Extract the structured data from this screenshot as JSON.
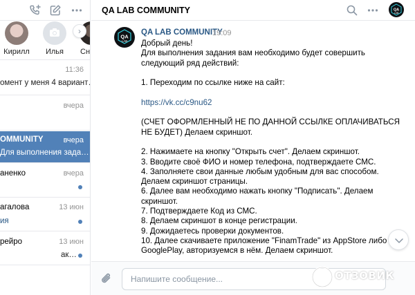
{
  "stories": [
    {
      "name": "Кирилл",
      "avatar_color": "#c4a9a3"
    },
    {
      "name": "Илья",
      "avatar_color": "#dfe3e8"
    },
    {
      "name": "Сне",
      "avatar_color": "#3b3431"
    }
  ],
  "dialogs": [
    {
      "name": "",
      "time": "11:36",
      "preview": "омент у меня 4 вариант…",
      "unread": false,
      "active": false
    },
    {
      "name": "",
      "time": "вчера",
      "preview": "",
      "unread": false,
      "active": false
    },
    {
      "name": "OMMUNITY",
      "time": "вчера",
      "preview": "Для выполнения зада…",
      "unread": false,
      "active": true
    },
    {
      "name": "аненко",
      "time": "вчера",
      "preview": "",
      "unread": true,
      "active": false
    },
    {
      "name": "агалова",
      "time": "13 июн",
      "preview": "ия",
      "unread": true,
      "active": false
    },
    {
      "name": "рейро",
      "time": "13 июн",
      "preview": "ак…",
      "unread": true,
      "active": false
    }
  ],
  "chat": {
    "title": "QA LAB COMMUNITY",
    "message": {
      "author": "QA LAB COMMUNITY",
      "time": "19:09",
      "lines": [
        "Добрый день!",
        "Для выполнения задания вам необходимо будет совершить",
        "следующий ряд действий:",
        "",
        "1. Переходим по ссылке ниже на сайт:",
        "",
        "https://vk.cc/c9nu62",
        "",
        "(СЧЕТ ОФОРМЛЕННЫЙ НЕ ПО ДАННОЙ ССЫЛКЕ ОПЛАЧИВАТЬСЯ",
        "НЕ БУДЕТ) Делаем скриншот.",
        "",
        "2. Нажимаете на кнопку \"Открыть счет\". Делаем скриншот.",
        "3. Вводите своё ФИО и номер телефона, подтверждаете СМС.",
        "4. Заполняете свои данные любым удобным для вас способом.",
        "Делаем скриншот страницы.",
        "6. Далее вам необходимо нажать кнопку \"Подписать\". Делаем",
        "скриншот.",
        "7. Подтверждаете Код из СМС.",
        "8. Делаем скриншот в конце регистрации.",
        "9. Дожидаетесь проверки документов.",
        "10. Далее скачиваете приложение \"FinamTrade\" из AppStore либо",
        "GooglePlay, авторизуемся в нём. Делаем скриншот."
      ],
      "link_line_index": 6
    },
    "composer": {
      "placeholder": "Напишите сообщение..."
    }
  },
  "avatar_logo": {
    "top": "QA",
    "bottom": "LAB"
  },
  "watermark": {
    "text": "ОТЗОВИК"
  },
  "colors": {
    "accent": "#5181b8",
    "link": "#2a5885",
    "icon": "#8a96a3",
    "muted": "#939393"
  }
}
